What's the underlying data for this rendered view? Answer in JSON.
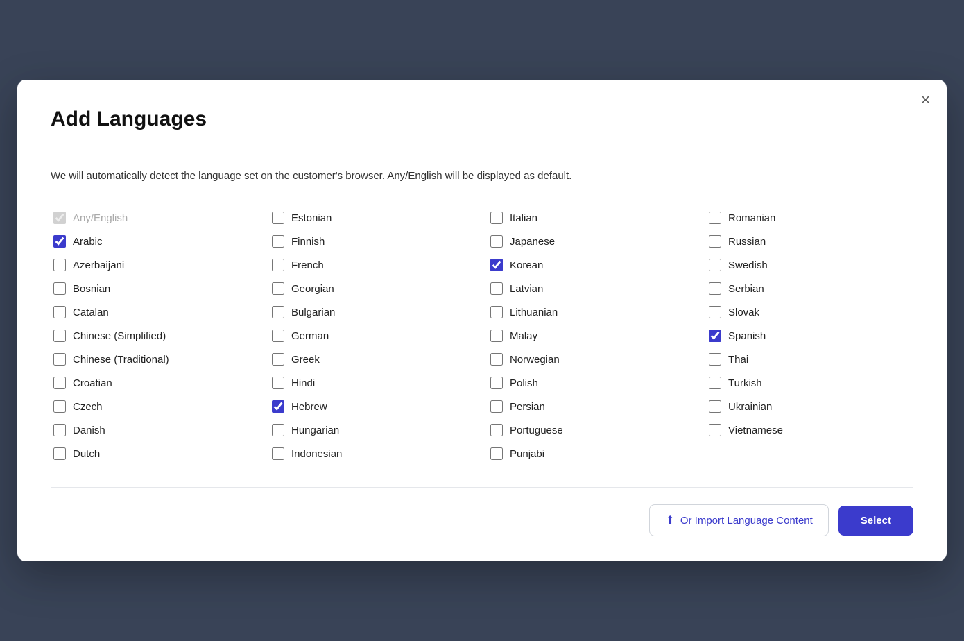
{
  "modal": {
    "title": "Add Languages",
    "close_label": "×",
    "description": "We will automatically detect the language set on the customer's browser. Any/English will be displayed as default.",
    "footer": {
      "import_button": "Or Import Language Content",
      "select_button": "Select"
    }
  },
  "columns": [
    {
      "id": "col1",
      "items": [
        {
          "id": "any_english",
          "label": "Any/English",
          "checked": true,
          "disabled": true
        },
        {
          "id": "arabic",
          "label": "Arabic",
          "checked": true,
          "disabled": false
        },
        {
          "id": "azerbaijani",
          "label": "Azerbaijani",
          "checked": false,
          "disabled": false
        },
        {
          "id": "bosnian",
          "label": "Bosnian",
          "checked": false,
          "disabled": false
        },
        {
          "id": "catalan",
          "label": "Catalan",
          "checked": false,
          "disabled": false
        },
        {
          "id": "chinese_simplified",
          "label": "Chinese (Simplified)",
          "checked": false,
          "disabled": false
        },
        {
          "id": "chinese_traditional",
          "label": "Chinese (Traditional)",
          "checked": false,
          "disabled": false
        },
        {
          "id": "croatian",
          "label": "Croatian",
          "checked": false,
          "disabled": false
        },
        {
          "id": "czech",
          "label": "Czech",
          "checked": false,
          "disabled": false
        },
        {
          "id": "danish",
          "label": "Danish",
          "checked": false,
          "disabled": false
        },
        {
          "id": "dutch",
          "label": "Dutch",
          "checked": false,
          "disabled": false
        }
      ]
    },
    {
      "id": "col2",
      "items": [
        {
          "id": "estonian",
          "label": "Estonian",
          "checked": false,
          "disabled": false
        },
        {
          "id": "finnish",
          "label": "Finnish",
          "checked": false,
          "disabled": false
        },
        {
          "id": "french",
          "label": "French",
          "checked": false,
          "disabled": false
        },
        {
          "id": "georgian",
          "label": "Georgian",
          "checked": false,
          "disabled": false
        },
        {
          "id": "bulgarian",
          "label": "Bulgarian",
          "checked": false,
          "disabled": false
        },
        {
          "id": "german",
          "label": "German",
          "checked": false,
          "disabled": false
        },
        {
          "id": "greek",
          "label": "Greek",
          "checked": false,
          "disabled": false
        },
        {
          "id": "hindi",
          "label": "Hindi",
          "checked": false,
          "disabled": false
        },
        {
          "id": "hebrew",
          "label": "Hebrew",
          "checked": true,
          "disabled": false
        },
        {
          "id": "hungarian",
          "label": "Hungarian",
          "checked": false,
          "disabled": false
        },
        {
          "id": "indonesian",
          "label": "Indonesian",
          "checked": false,
          "disabled": false
        }
      ]
    },
    {
      "id": "col3",
      "items": [
        {
          "id": "italian",
          "label": "Italian",
          "checked": false,
          "disabled": false
        },
        {
          "id": "japanese",
          "label": "Japanese",
          "checked": false,
          "disabled": false
        },
        {
          "id": "korean",
          "label": "Korean",
          "checked": true,
          "disabled": false
        },
        {
          "id": "latvian",
          "label": "Latvian",
          "checked": false,
          "disabled": false
        },
        {
          "id": "lithuanian",
          "label": "Lithuanian",
          "checked": false,
          "disabled": false
        },
        {
          "id": "malay",
          "label": "Malay",
          "checked": false,
          "disabled": false
        },
        {
          "id": "norwegian",
          "label": "Norwegian",
          "checked": false,
          "disabled": false
        },
        {
          "id": "polish",
          "label": "Polish",
          "checked": false,
          "disabled": false
        },
        {
          "id": "persian",
          "label": "Persian",
          "checked": false,
          "disabled": false
        },
        {
          "id": "portuguese",
          "label": "Portuguese",
          "checked": false,
          "disabled": false
        },
        {
          "id": "punjabi",
          "label": "Punjabi",
          "checked": false,
          "disabled": false
        }
      ]
    },
    {
      "id": "col4",
      "items": [
        {
          "id": "romanian",
          "label": "Romanian",
          "checked": false,
          "disabled": false
        },
        {
          "id": "russian",
          "label": "Russian",
          "checked": false,
          "disabled": false
        },
        {
          "id": "swedish",
          "label": "Swedish",
          "checked": false,
          "disabled": false
        },
        {
          "id": "serbian",
          "label": "Serbian",
          "checked": false,
          "disabled": false
        },
        {
          "id": "slovak",
          "label": "Slovak",
          "checked": false,
          "disabled": false
        },
        {
          "id": "spanish",
          "label": "Spanish",
          "checked": true,
          "disabled": false
        },
        {
          "id": "thai",
          "label": "Thai",
          "checked": false,
          "disabled": false
        },
        {
          "id": "turkish",
          "label": "Turkish",
          "checked": false,
          "disabled": false
        },
        {
          "id": "ukrainian",
          "label": "Ukrainian",
          "checked": false,
          "disabled": false
        },
        {
          "id": "vietnamese",
          "label": "Vietnamese",
          "checked": false,
          "disabled": false
        }
      ]
    }
  ]
}
